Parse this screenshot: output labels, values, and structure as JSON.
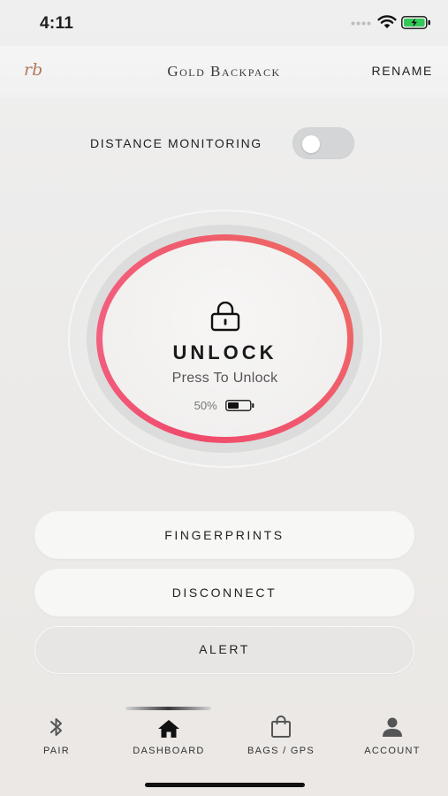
{
  "status": {
    "time": "4:11",
    "battery_color": "#34c759"
  },
  "header": {
    "logo": "rb",
    "title": "Gold Backpack",
    "rename_label": "RENAME"
  },
  "distance_monitoring": {
    "label": "DISTANCE MONITORING",
    "enabled": false
  },
  "lock": {
    "icon": "lock-icon",
    "action_label": "UNLOCK",
    "hint": "Press To Unlock",
    "battery_level": "50%",
    "ring_color": "#f04a6a"
  },
  "buttons": {
    "fingerprints": "FINGERPRINTS",
    "disconnect": "DISCONNECT",
    "alert": "ALERT"
  },
  "tabs": [
    {
      "label": "PAIR",
      "icon": "bluetooth-icon"
    },
    {
      "label": "DASHBOARD",
      "icon": "home-icon",
      "active": true
    },
    {
      "label": "BAGS / GPS",
      "icon": "bag-icon"
    },
    {
      "label": "ACCOUNT",
      "icon": "person-icon"
    }
  ]
}
